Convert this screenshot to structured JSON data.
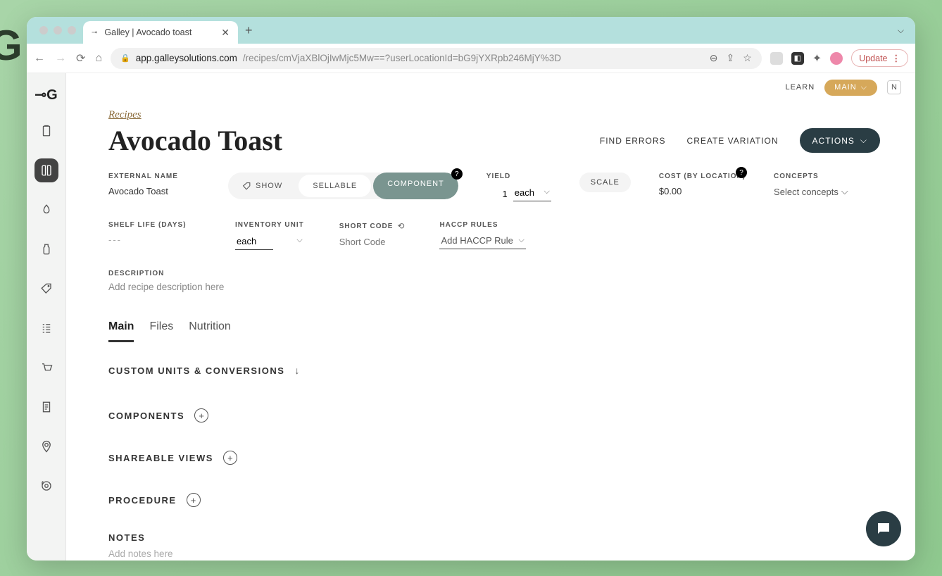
{
  "browser": {
    "tab_title": "Galley | Avocado toast",
    "url_domain": "app.galleysolutions.com",
    "url_path": "/recipes/cmVjaXBlOjIwMjc5Mw==?userLocationId=bG9jYXRpb246MjY%3D",
    "update_label": "Update"
  },
  "topbar": {
    "learn": "LEARN",
    "main_pill": "MAIN",
    "avatar_initial": "N"
  },
  "page": {
    "breadcrumb": "Recipes",
    "title": "Avocado Toast",
    "actions": {
      "find_errors": "FIND ERRORS",
      "create_variation": "CREATE VARIATION",
      "actions_btn": "ACTIONS"
    },
    "external_name": {
      "label": "EXTERNAL NAME",
      "value": "Avocado Toast"
    },
    "type_pills": {
      "show": "SHOW",
      "sellable": "SELLABLE",
      "component": "COMPONENT"
    },
    "yield": {
      "label": "YIELD",
      "value": "1",
      "unit": "each"
    },
    "scale": "SCALE",
    "cost": {
      "label": "COST (BY LOCATION)",
      "value": "$0.00"
    },
    "concepts": {
      "label": "CONCEPTS",
      "placeholder": "Select concepts"
    },
    "shelf_life": {
      "label": "SHELF LIFE (DAYS)",
      "value": "---"
    },
    "inventory_unit": {
      "label": "INVENTORY UNIT",
      "value": "each"
    },
    "short_code": {
      "label": "SHORT CODE",
      "placeholder": "Short Code"
    },
    "haccp": {
      "label": "HACCP RULES",
      "placeholder": "Add HACCP Rule"
    },
    "description": {
      "label": "DESCRIPTION",
      "placeholder": "Add recipe description here"
    },
    "tabs": {
      "main": "Main",
      "files": "Files",
      "nutrition": "Nutrition"
    },
    "sections": {
      "custom_units": "CUSTOM UNITS & CONVERSIONS",
      "components": "COMPONENTS",
      "shareable": "SHAREABLE VIEWS",
      "procedure": "PROCEDURE",
      "notes": "NOTES",
      "notes_placeholder": "Add notes here"
    }
  }
}
